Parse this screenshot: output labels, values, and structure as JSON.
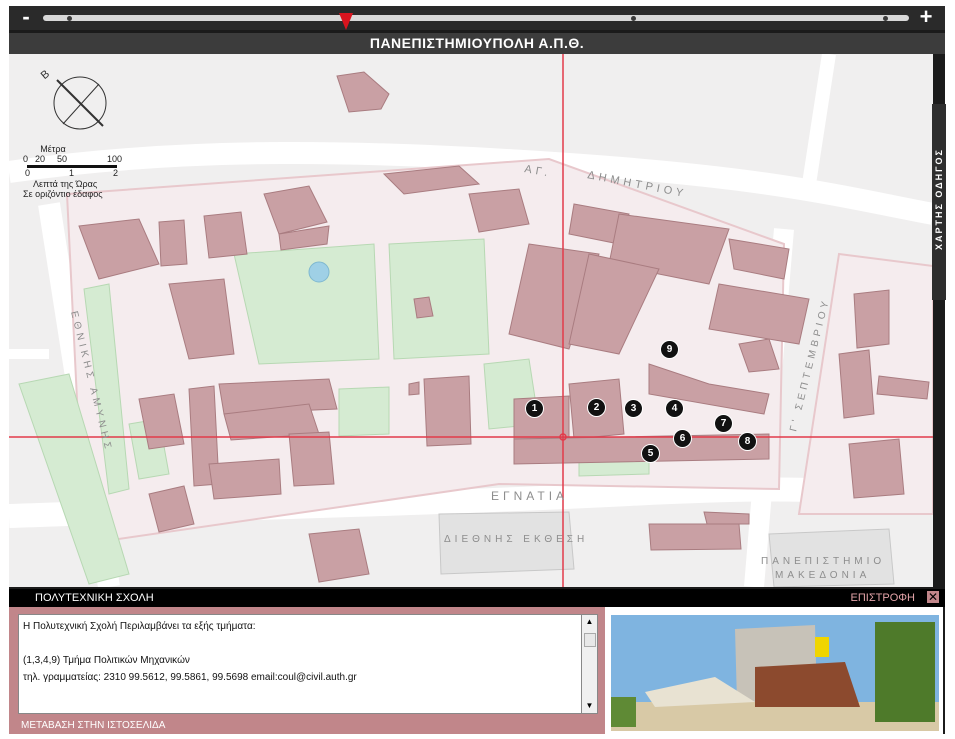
{
  "zoom": {
    "minus_label": "-",
    "plus_label": "+",
    "level": 0.35
  },
  "title": "ΠΑΝΕΠΙΣΤΗΜΙΟΥΠΟΛΗ Α.Π.Θ.",
  "side_tab": "ΧΑΡΤΗΣ ΟΔΗΓΟΣ",
  "compass": {
    "north_label": "B",
    "icon": "compass-icon"
  },
  "scale": {
    "title": "Μέτρα",
    "meters_ticks": [
      "0",
      "20",
      "50",
      "100"
    ],
    "minutes_ticks": [
      "0",
      "1",
      "2"
    ],
    "minutes_label": "Λεπτά της Ώρας",
    "ground_label": "Σε οριζόντιο έδαφος"
  },
  "streets": {
    "ag_dimitriou_left": "ΑΓ.",
    "ag_dimitriou_right": "ΔΗΜΗΤΡΙΟΥ",
    "egnatia": "ΕΓΝΑΤΙΑ",
    "ethnikis_amynis": "ΕΘΝΙΚΗΣ ΑΜΥΝΗΣ",
    "sept_3": "Γ' ΣΕΠΤΕΜΒΡΙΟΥ",
    "diethnis_ekthesi": "ΔΙΕΘΝΗΣ ΕΚΘΕΣΗ",
    "panepistimio_1": "ΠΑΝΕΠΙΣΤΗΜΙΟ",
    "panepistimio_2": "ΜΑΚΕΔΟΝΙΑ"
  },
  "markers": [
    "1",
    "2",
    "3",
    "4",
    "5",
    "6",
    "7",
    "8",
    "9"
  ],
  "info": {
    "section_title": "ΠΟΛΥΤΕΧΝΙΚΗ ΣΧΟΛΗ",
    "back_label": "ΕΠΙΣΤΡΟΦΗ",
    "line1": "Η Πολυτεχνική Σχολή Περιλαμβάνει τα εξής τμήματα:",
    "line2": "(1,3,4,9) Τμήμα Πολιτικών Μηχανικών",
    "line3": "τηλ. γραμματείας: 2310 99.5612, 99.5861, 99.5698 email:coul@civil.auth.gr",
    "link_label": "ΜΕΤΑΒΑΣΗ ΣΤΗΝ ΙΣΤΟΣΕΛΙΔΑ"
  },
  "colors": {
    "building": "#c9a0a4",
    "green": "#d5ebd2",
    "campus": "#f5ecee",
    "crosshair": "#e23a4a"
  }
}
